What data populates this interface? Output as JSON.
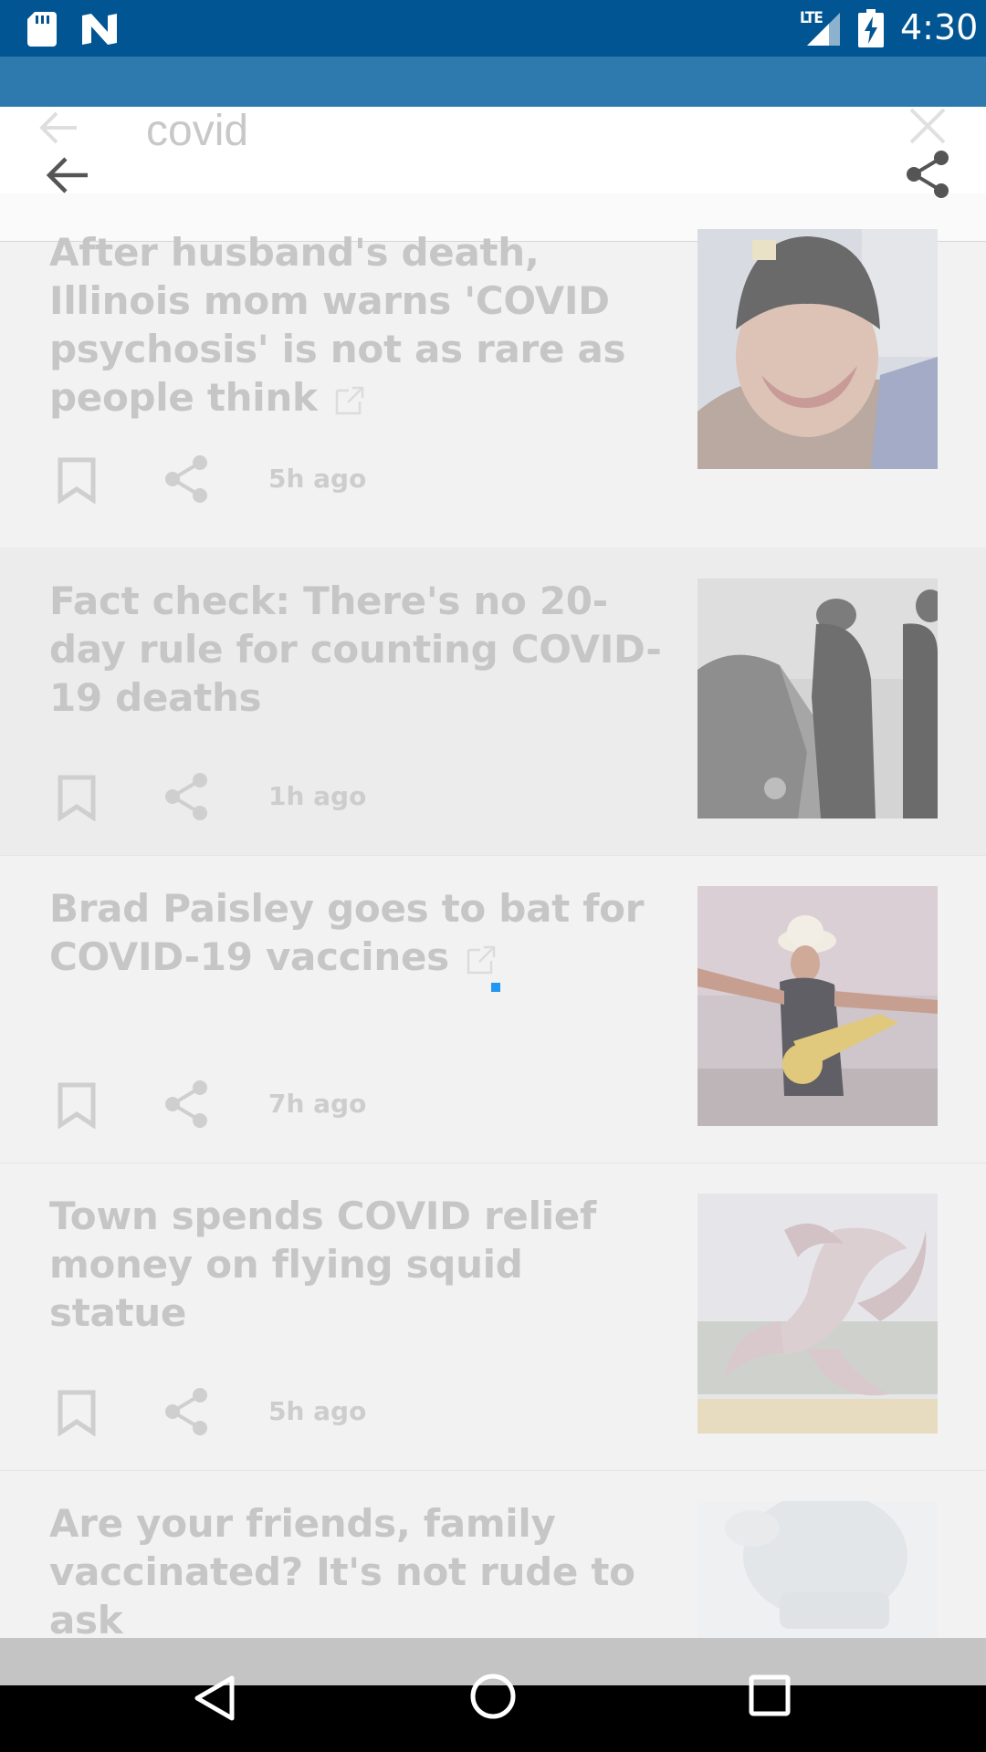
{
  "status_bar": {
    "network": "LTE",
    "time": "4:30",
    "icons": [
      "sd-card-icon",
      "n-notification-icon",
      "signal-icon",
      "battery-charging-icon"
    ]
  },
  "search": {
    "query": "covid",
    "icons": [
      "back-arrow-icon",
      "close-icon",
      "share-icon"
    ]
  },
  "articles": [
    {
      "headline": "After husband's death, Illinois mom warns 'COVID psychosis' is not as rare as people think",
      "external": true,
      "time": "5h ago",
      "thumb_desc": "man-in-beanie-photo"
    },
    {
      "headline": "Fact check: There's no 20-day rule for counting COVID-19 deaths",
      "external": false,
      "time": "1h ago",
      "thumb_desc": "drive-through-testing-photo"
    },
    {
      "headline": "Brad Paisley goes to bat for COVID-19 vaccines",
      "external": true,
      "time": "7h ago",
      "thumb_desc": "guitarist-on-stage-photo"
    },
    {
      "headline": "Town spends COVID relief money on flying squid statue",
      "external": false,
      "time": "5h ago",
      "thumb_desc": "squid-statue-photo"
    },
    {
      "headline": "Are your friends, family vaccinated? It's not rude to ask",
      "external": false,
      "time": "",
      "thumb_desc": "vaccination-photo"
    }
  ],
  "colors": {
    "status_bar": "#005592",
    "toolbar": "#2e79ad",
    "headline_faded": "#c6c6c6",
    "loading": "#2196f3"
  }
}
